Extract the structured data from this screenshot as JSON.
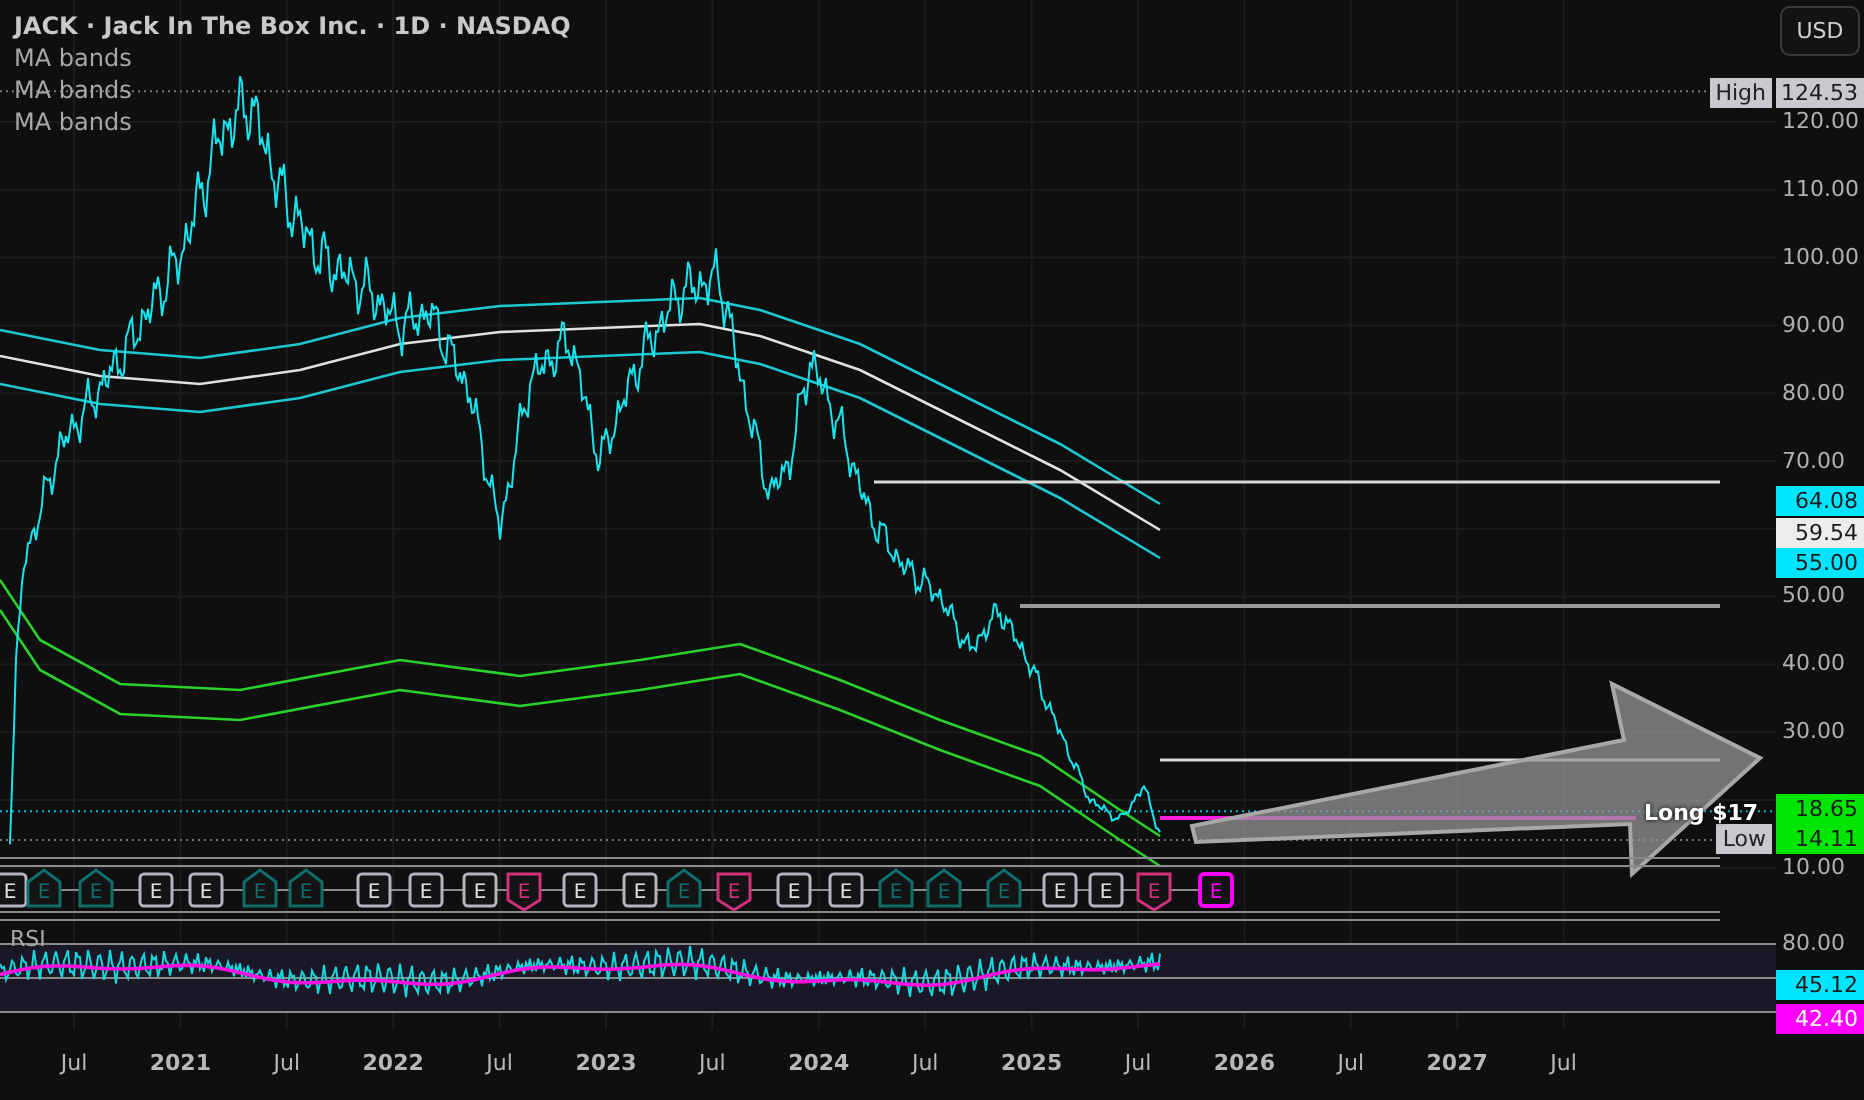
{
  "legend": {
    "title": "JACK · Jack In The Box Inc. · 1D · NASDAQ",
    "indicators": [
      "MA bands",
      "MA bands",
      "MA bands"
    ]
  },
  "currency_button": "USD",
  "price_axis": {
    "ticks": [
      "120.00",
      "110.00",
      "100.00",
      "90.00",
      "80.00",
      "70.00",
      "50.00",
      "40.00",
      "30.00",
      "10.00"
    ]
  },
  "price_tags": [
    {
      "label": "High",
      "value": "124.53",
      "color": "#c8c9cf"
    },
    {
      "value": "64.08",
      "color": "#00e5ff"
    },
    {
      "value": "59.54",
      "color": "#ececec"
    },
    {
      "value": "55.00",
      "color": "#00e5ff"
    },
    {
      "value": "18.65",
      "color": "#00e600"
    },
    {
      "label": "Low",
      "value": "14.11",
      "color": "#00e600"
    }
  ],
  "drawing_label": "Long $17",
  "earnings": [
    {
      "label": "E",
      "kind": "box",
      "color": "#b2b5be"
    },
    {
      "label": "E",
      "kind": "house",
      "color": "#0e6e6b"
    },
    {
      "label": "E",
      "kind": "house",
      "color": "#0e6e6b"
    },
    {
      "label": "E",
      "kind": "box",
      "color": "#b2b5be"
    },
    {
      "label": "E",
      "kind": "box",
      "color": "#b2b5be"
    },
    {
      "label": "E",
      "kind": "house",
      "color": "#0e6e6b"
    },
    {
      "label": "E",
      "kind": "house",
      "color": "#0e6e6b"
    },
    {
      "label": "E",
      "kind": "box",
      "color": "#b2b5be"
    },
    {
      "label": "E",
      "kind": "box",
      "color": "#b2b5be"
    },
    {
      "label": "E",
      "kind": "box",
      "color": "#b2b5be"
    },
    {
      "label": "E",
      "kind": "shield",
      "color": "#d0317a"
    },
    {
      "label": "E",
      "kind": "box",
      "color": "#b2b5be"
    },
    {
      "label": "E",
      "kind": "box",
      "color": "#b2b5be"
    },
    {
      "label": "E",
      "kind": "house",
      "color": "#0e6e6b"
    },
    {
      "label": "E",
      "kind": "shield",
      "color": "#d0317a"
    },
    {
      "label": "E",
      "kind": "box",
      "color": "#b2b5be"
    },
    {
      "label": "E",
      "kind": "box",
      "color": "#b2b5be"
    },
    {
      "label": "E",
      "kind": "house",
      "color": "#0e6e6b"
    },
    {
      "label": "E",
      "kind": "house",
      "color": "#0e6e6b"
    },
    {
      "label": "E",
      "kind": "house",
      "color": "#0e6e6b"
    },
    {
      "label": "E",
      "kind": "box",
      "color": "#b2b5be"
    },
    {
      "label": "E",
      "kind": "box",
      "color": "#b2b5be"
    },
    {
      "label": "E",
      "kind": "shield",
      "color": "#d0317a"
    },
    {
      "label": "E",
      "kind": "upcoming",
      "color": "#ff00ff"
    }
  ],
  "rsi": {
    "title": "RSI",
    "ticks": [
      "80.00"
    ],
    "tags": [
      {
        "value": "45.12",
        "color": "#00e5ff"
      },
      {
        "value": "42.40",
        "color": "#ff00ff"
      }
    ]
  },
  "time_axis": [
    {
      "label": "Jul",
      "kind": "month"
    },
    {
      "label": "2021",
      "kind": "year"
    },
    {
      "label": "Jul",
      "kind": "month"
    },
    {
      "label": "2022",
      "kind": "year"
    },
    {
      "label": "Jul",
      "kind": "month"
    },
    {
      "label": "2023",
      "kind": "year"
    },
    {
      "label": "Jul",
      "kind": "month"
    },
    {
      "label": "2024",
      "kind": "year"
    },
    {
      "label": "Jul",
      "kind": "month"
    },
    {
      "label": "2025",
      "kind": "year"
    },
    {
      "label": "Jul",
      "kind": "month"
    },
    {
      "label": "2026",
      "kind": "year"
    },
    {
      "label": "Jul",
      "kind": "month"
    },
    {
      "label": "2027",
      "kind": "year"
    },
    {
      "label": "Jul",
      "kind": "month"
    }
  ]
}
